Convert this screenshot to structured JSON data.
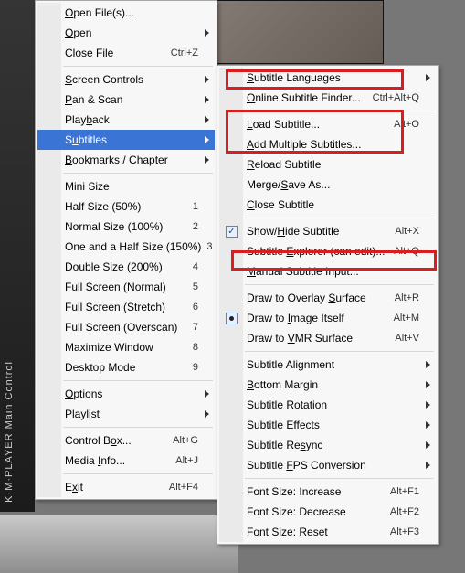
{
  "sidebar_label": "K·M·PLAYER  Main  Control",
  "main_menu": {
    "open_files": "Open File(s)...",
    "open": "Open",
    "close_file": "Close File",
    "close_file_sc": "Ctrl+Z",
    "screen_controls": "Screen Controls",
    "pan_scan": "Pan & Scan",
    "playback": "Playback",
    "subtitles": "Subtitles",
    "bookmarks": "Bookmarks / Chapter",
    "mini_size": "Mini Size",
    "half_size": "Half Size (50%)",
    "half_size_sc": "1",
    "normal_size": "Normal Size (100%)",
    "normal_size_sc": "2",
    "one_half": "One and a Half Size (150%)",
    "one_half_sc": "3",
    "double": "Double Size (200%)",
    "double_sc": "4",
    "fs_normal": "Full Screen (Normal)",
    "fs_normal_sc": "5",
    "fs_stretch": "Full Screen (Stretch)",
    "fs_stretch_sc": "6",
    "fs_overscan": "Full Screen (Overscan)",
    "fs_overscan_sc": "7",
    "max_win": "Maximize Window",
    "max_win_sc": "8",
    "desktop": "Desktop Mode",
    "desktop_sc": "9",
    "options": "Options",
    "playlist": "Playlist",
    "control_box": "Control Box...",
    "control_box_sc": "Alt+G",
    "media_info": "Media Info...",
    "media_info_sc": "Alt+J",
    "exit": "Exit",
    "exit_sc": "Alt+F4"
  },
  "sub_menu": {
    "languages": "Subtitle Languages",
    "online_finder": "Online Subtitle Finder...",
    "online_finder_sc": "Ctrl+Alt+Q",
    "load": "Load Subtitle...",
    "load_sc": "Alt+O",
    "add_multiple": "Add Multiple Subtitles...",
    "reload": "Reload Subtitle",
    "merge": "Merge/Save As...",
    "close": "Close Subtitle",
    "show_hide": "Show/Hide Subtitle",
    "show_hide_sc": "Alt+X",
    "explorer": "Subtitle Explorer (can edit)...",
    "explorer_sc": "Alt+Q",
    "manual": "Manual Subtitle Input...",
    "overlay": "Draw to Overlay Surface",
    "overlay_sc": "Alt+R",
    "image_itself": "Draw to Image Itself",
    "image_itself_sc": "Alt+M",
    "vmr": "Draw to VMR Surface",
    "vmr_sc": "Alt+V",
    "alignment": "Subtitle Alignment",
    "bottom_margin": "Bottom Margin",
    "rotation": "Subtitle Rotation",
    "effects": "Subtitle Effects",
    "resync": "Subtitle Resync",
    "fps": "Subtitle FPS Conversion",
    "inc": "Font Size: Increase",
    "inc_sc": "Alt+F1",
    "dec": "Font Size: Decrease",
    "dec_sc": "Alt+F2",
    "reset": "Font Size: Reset",
    "reset_sc": "Alt+F3"
  }
}
